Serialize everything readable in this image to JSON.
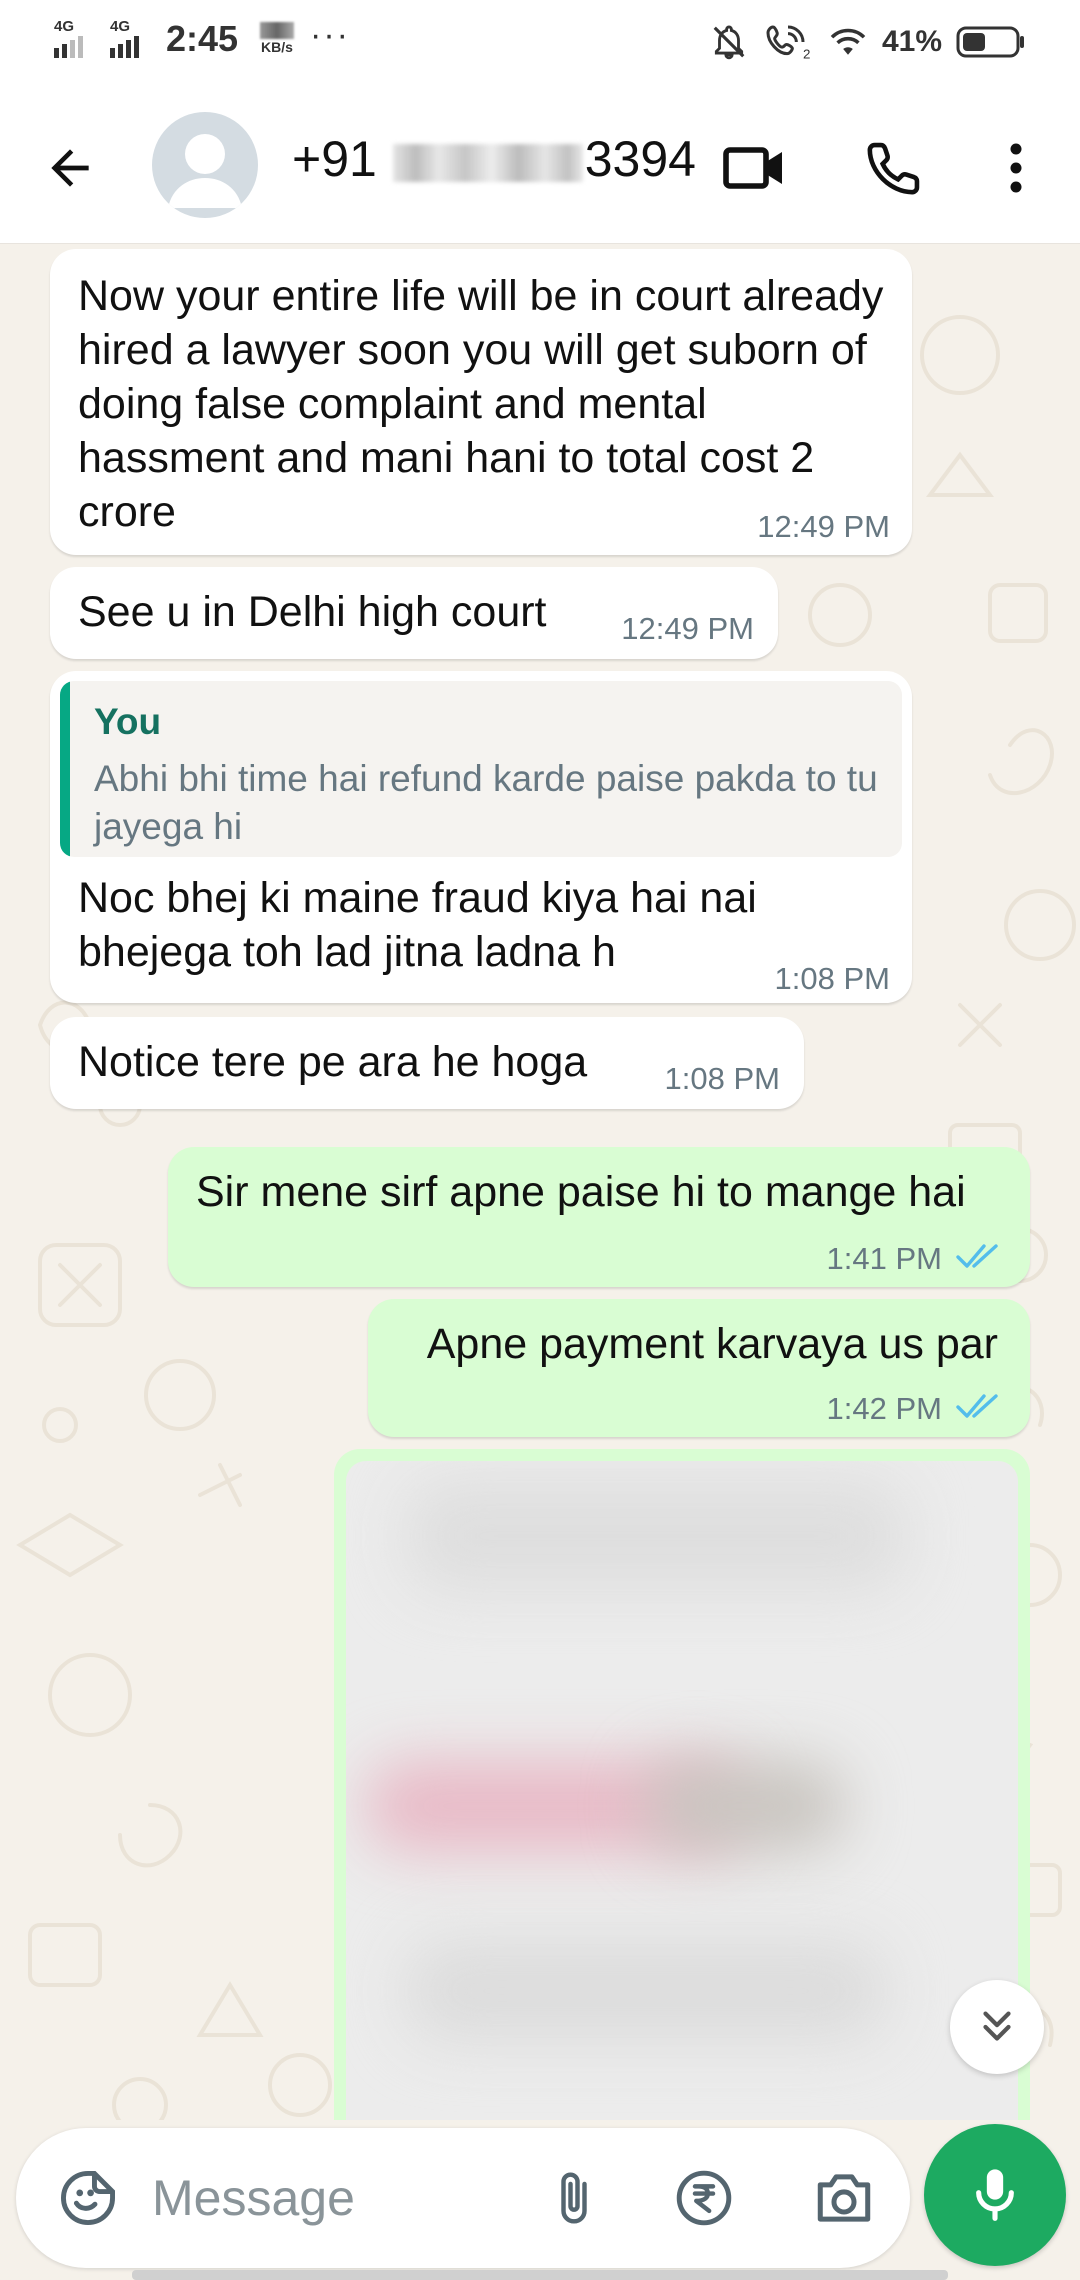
{
  "status_bar": {
    "network_1": "4G",
    "network_2": "4G",
    "time": "2:45",
    "speed_unit": "KB/s",
    "more": "···",
    "battery_percent": "41%"
  },
  "header": {
    "contact_prefix": "+91",
    "contact_suffix": "3394"
  },
  "messages": [
    {
      "direction": "incoming",
      "text": "Now your entire life will be in court already hired a lawyer soon you will get suborn of doing false complaint and mental hassment and mani hani to total cost 2 crore",
      "time": "12:49 PM"
    },
    {
      "direction": "incoming",
      "text": "See u in Delhi high court",
      "time": "12:49 PM"
    },
    {
      "direction": "incoming",
      "reply_to": {
        "sender": "You",
        "text": "Abhi bhi time hai refund karde paise pakda to tu jayega hi"
      },
      "text": "Noc bhej ki maine fraud kiya hai nai bhejega toh lad jitna ladna h",
      "time": "1:08 PM"
    },
    {
      "direction": "incoming",
      "text": "Notice tere pe ara he hoga",
      "time": "1:08 PM"
    },
    {
      "direction": "outgoing",
      "text": "Sir mene sirf apne paise hi to mange hai",
      "time": "1:41 PM",
      "status": "read"
    },
    {
      "direction": "outgoing",
      "text": "Apne payment karvaya us par",
      "time": "1:42 PM",
      "status": "read"
    },
    {
      "direction": "outgoing",
      "type": "image"
    }
  ],
  "composer": {
    "placeholder": "Message"
  },
  "colors": {
    "incoming_bubble": "#ffffff",
    "outgoing_bubble": "#d9fdd3",
    "chat_background": "#f5f1ea",
    "accent_green": "#1daa61",
    "read_ticks": "#53bdeb",
    "quote_bar": "#06a884"
  },
  "icons": [
    "back-arrow-icon",
    "avatar-icon",
    "video-call-icon",
    "phone-icon",
    "more-vert-icon",
    "sticker-icon",
    "attach-icon",
    "rupee-icon",
    "camera-icon",
    "mic-icon",
    "scroll-down-icon"
  ]
}
